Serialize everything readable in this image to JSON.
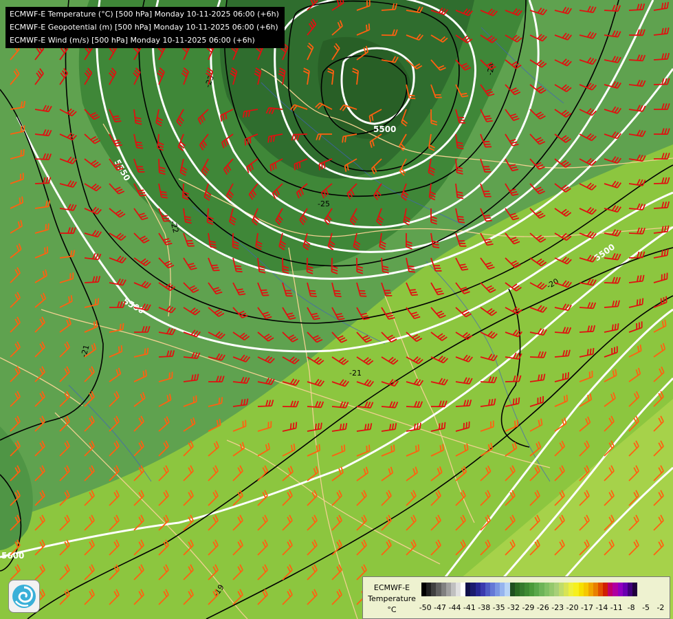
{
  "header": {
    "line1": "ECMWF-E Temperature (°C) [500 hPa] Monday 10-11-2025 06:00 (+6h)",
    "line2": "ECMWF-E Geopotential (m) [500 hPa] Monday 10-11-2025 06:00 (+6h)",
    "line3": "ECMWF-E Wind (m/s) [500 hPa] Monday 10-11-2025 06:00 (+6h)"
  },
  "geopotential_labels": [
    "5500",
    "5550",
    "5550",
    "5500",
    "5500",
    "5600"
  ],
  "temperature_labels": [
    "-23",
    "-24",
    "-25",
    "-22",
    "-21",
    "-21",
    "-20",
    "-19"
  ],
  "legend": {
    "title_line1": "ECMWF-E",
    "title_line2": "Temperature",
    "title_line3": "°C",
    "ticks": [
      "-50",
      "-47",
      "-44",
      "-41",
      "-38",
      "-35",
      "-32",
      "-29",
      "-26",
      "-23",
      "-20",
      "-17",
      "-14",
      "-11",
      "-8",
      "-5",
      "-2"
    ],
    "colors": [
      "#000000",
      "#202020",
      "#404040",
      "#606060",
      "#808080",
      "#a0a0a0",
      "#c0c0c0",
      "#e0e0e0",
      "#ffffff",
      "#10104a",
      "#1c1c6e",
      "#282892",
      "#3a3aae",
      "#4f5cc4",
      "#6478d6",
      "#7a96e2",
      "#96b4ee",
      "#b8d4f6",
      "#1f4f1f",
      "#2a6a22",
      "#357a2c",
      "#3e8a32",
      "#4a9a3a",
      "#5aa84a",
      "#6db458",
      "#80c064",
      "#94c86c",
      "#a8d078",
      "#c0dc6a",
      "#d8e454",
      "#eef03c",
      "#f6f01e",
      "#f6e000",
      "#f6c800",
      "#f0a400",
      "#e88000",
      "#e05000",
      "#d02000",
      "#c0006a",
      "#b000a0",
      "#9000c0",
      "#6a00b0",
      "#40007a",
      "#20003c"
    ]
  },
  "map_colors": {
    "warm_green": "#8cc63f",
    "mid_green": "#5fa24f",
    "cold_green": "#2f6d2e",
    "coldest_green": "#285f26",
    "far_green": "#a6d24a",
    "isohypse": "#ffffff",
    "isotherm": "#000000",
    "wind_strong": "#e01010",
    "wind_weak": "#ff6010",
    "border": "#f0d090",
    "river": "#4060c0"
  }
}
